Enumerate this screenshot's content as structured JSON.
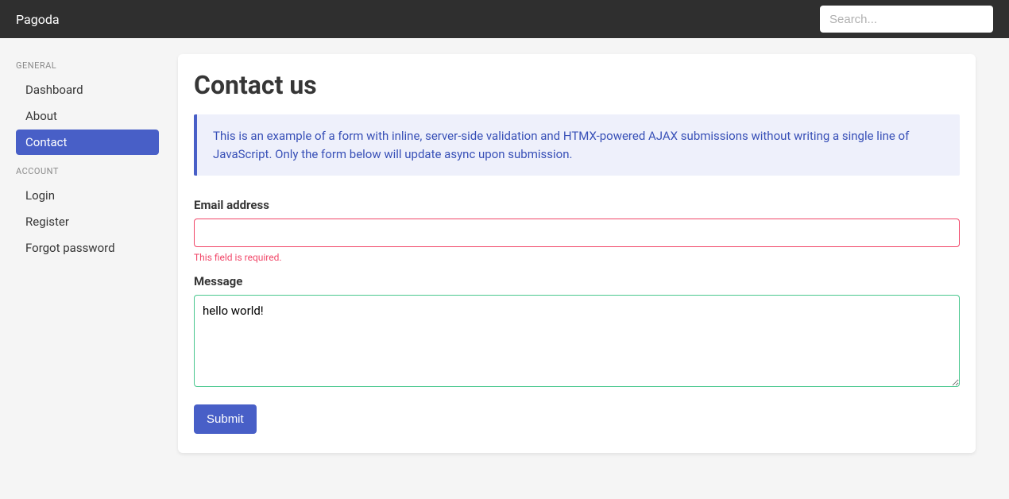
{
  "navbar": {
    "brand": "Pagoda",
    "search_placeholder": "Search..."
  },
  "sidebar": {
    "sections": [
      {
        "label": "GENERAL",
        "items": [
          {
            "label": "Dashboard",
            "name": "dashboard",
            "active": false
          },
          {
            "label": "About",
            "name": "about",
            "active": false
          },
          {
            "label": "Contact",
            "name": "contact",
            "active": true
          }
        ]
      },
      {
        "label": "ACCOUNT",
        "items": [
          {
            "label": "Login",
            "name": "login",
            "active": false
          },
          {
            "label": "Register",
            "name": "register",
            "active": false
          },
          {
            "label": "Forgot password",
            "name": "forgot-password",
            "active": false
          }
        ]
      }
    ]
  },
  "page": {
    "title": "Contact us",
    "info_text": "This is an example of a form with inline, server-side validation and HTMX-powered AJAX submissions without writing a single line of JavaScript. Only the form below will update async upon submission."
  },
  "form": {
    "email": {
      "label": "Email address",
      "value": "",
      "error": "This field is required."
    },
    "message": {
      "label": "Message",
      "value": "hello world!"
    },
    "submit_label": "Submit"
  }
}
